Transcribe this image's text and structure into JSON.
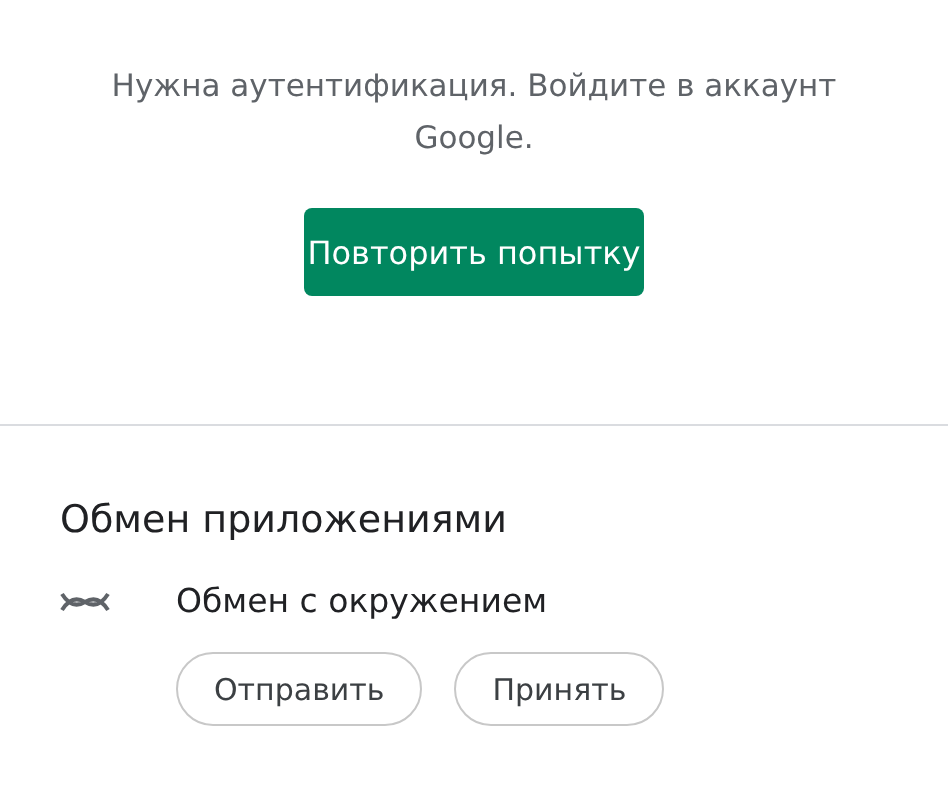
{
  "auth": {
    "message": "Нужна аутентификация. Войдите в аккаунт Google.",
    "retry_button": "Повторить попытку"
  },
  "app_sharing": {
    "title": "Обмен приложениями",
    "item": "Обмен с окружением",
    "buttons": [
      "Отправить",
      "Принять"
    ]
  }
}
